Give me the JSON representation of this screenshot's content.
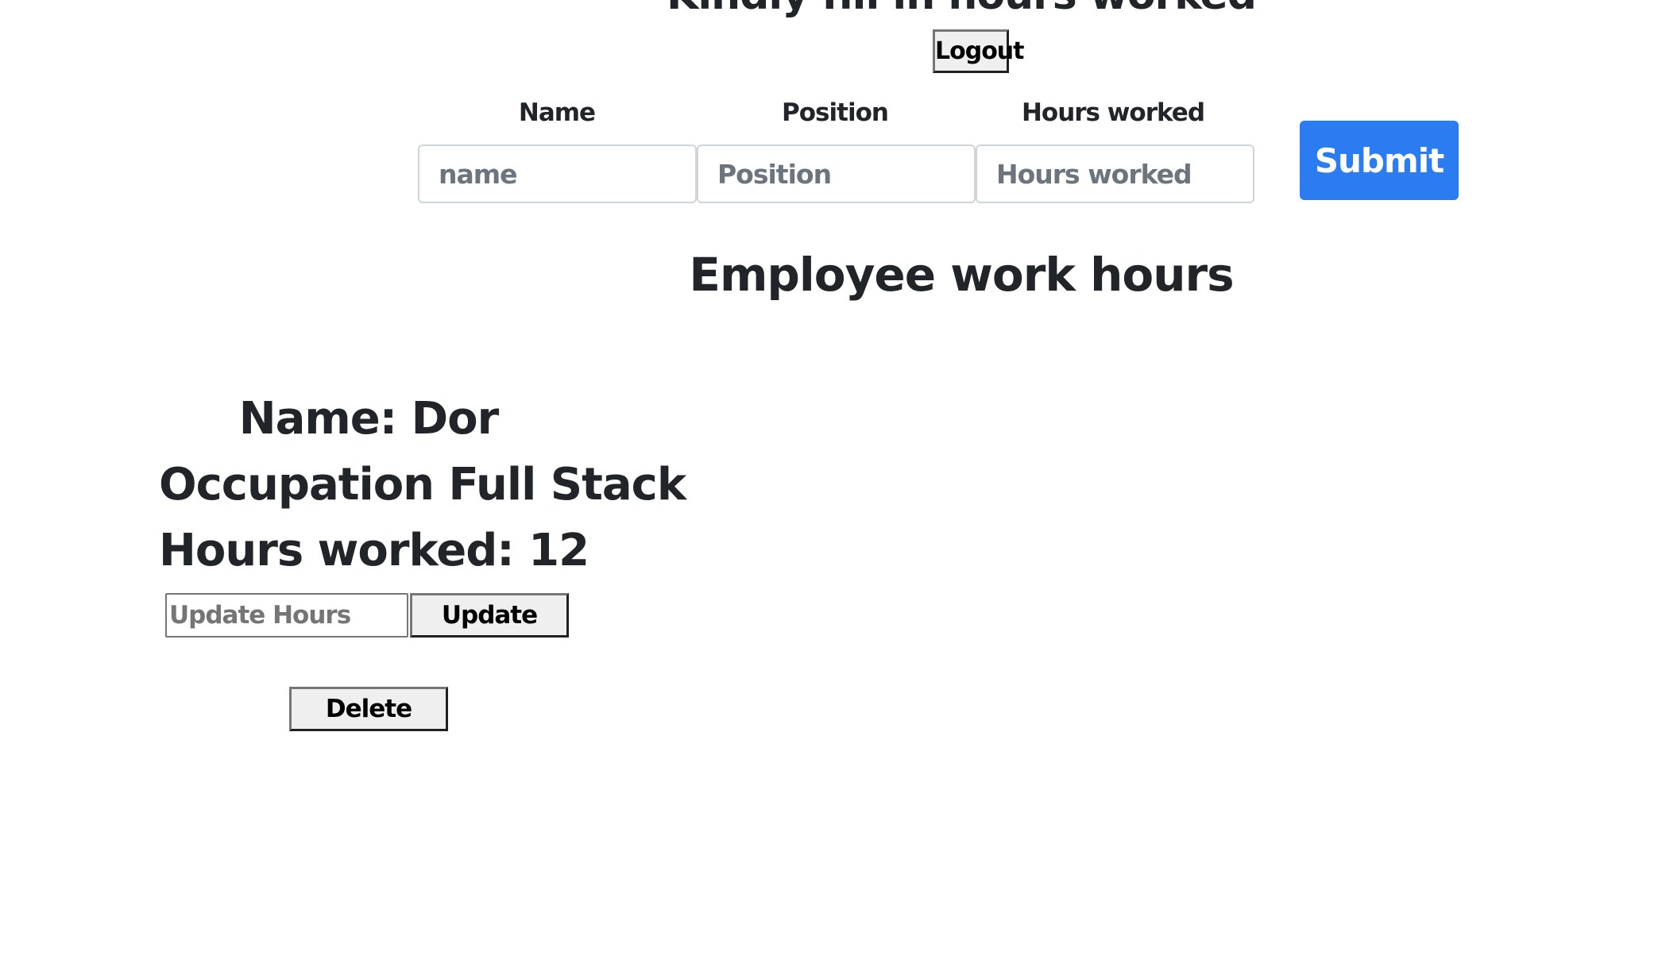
{
  "header": {
    "title": "Kindly fill in hours worked",
    "logout_label": "Logout"
  },
  "form": {
    "name_label": "Name",
    "position_label": "Position",
    "hours_label": "Hours worked",
    "name_placeholder": "name",
    "position_placeholder": "Position",
    "hours_placeholder": "Hours worked",
    "submit_label": "Submit"
  },
  "list": {
    "title": "Employee work hours"
  },
  "employees": [
    {
      "name_line": "Name: Dor",
      "occupation_line": "Occupation Full Stack",
      "hours_line": "Hours worked: 12",
      "update_placeholder": "Update Hours",
      "update_label": "Update",
      "delete_label": "Delete"
    }
  ],
  "colors": {
    "text": "#212529",
    "submit_bg": "#2b7cf0",
    "button_bg": "#efefef",
    "input_border": "#ced4da"
  }
}
